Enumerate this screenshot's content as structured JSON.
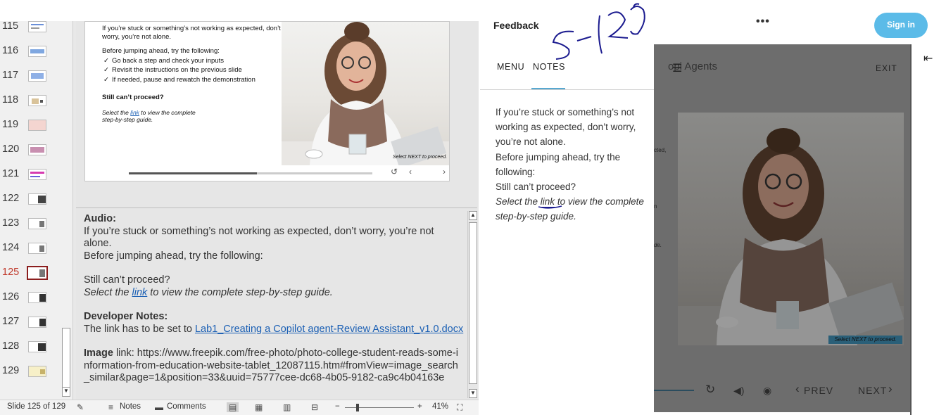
{
  "thumbnails": [
    {
      "num": "115"
    },
    {
      "num": "116"
    },
    {
      "num": "117"
    },
    {
      "num": "118"
    },
    {
      "num": "119"
    },
    {
      "num": "120"
    },
    {
      "num": "121"
    },
    {
      "num": "122"
    },
    {
      "num": "123"
    },
    {
      "num": "124"
    },
    {
      "num": "125"
    },
    {
      "num": "126"
    },
    {
      "num": "127"
    },
    {
      "num": "128"
    },
    {
      "num": "129"
    }
  ],
  "current_slide_num": "125",
  "slide": {
    "p1": "If you’re stuck or something’s not working as expected, don’t worry, you’re not alone.",
    "p2": "Before jumping ahead, try the following:",
    "checks": [
      "Go back a step and check your inputs",
      "Revisit the instructions on the previous slide",
      "If needed, pause and rewatch the demonstration"
    ],
    "bold": "Still can’t proceed?",
    "ital_pre": "Select the ",
    "ital_link": "link",
    "ital_post": " to view the complete step-by-step guide.",
    "photo_caption": "Select NEXT to proceed."
  },
  "notes": {
    "audio_heading": "Audio:",
    "audio_line1": "If you’re stuck or something’s not working as expected, don’t worry, you’re not alone.",
    "audio_line2": "Before jumping ahead, try the following:",
    "audio_line3": "Still can’t proceed?",
    "audio_ital_pre": "Select the ",
    "audio_ital_link": "link",
    "audio_ital_post": " to view the complete step-by-step guide.",
    "dev_heading": "Developer Notes:",
    "dev_pre": "The link has to be set to ",
    "dev_link": "Lab1_Creating a Copilot agent-Review Assistant_v1.0.docx",
    "image_heading": "Image",
    "image_text": " link: https://www.freepik.com/free-photo/photo-college-student-reads-some-information-from-education-website-tablet_12087115.htm#fromView=image_search_similar&page=1&position=33&uuid=75777cee-dc68-4b05-9182-ca9c4b04163e"
  },
  "status": {
    "slide_info": "Slide 125 of 129",
    "notes": "Notes",
    "comments": "Comments",
    "zoom_minus": "−",
    "zoom_plus": "+",
    "zoom": "41%"
  },
  "feedback": {
    "title": "Feedback",
    "more": "•••",
    "sign_in": "Sign in",
    "tab_menu": "MENU",
    "tab_notes": "NOTES",
    "course_title": "opi  Agents",
    "exit": "EXIT",
    "panel_line1": "If you’re stuck or something’s not working as expected, don’t worry, you’re not alone.",
    "panel_line2": "Before jumping ahead, try the following:",
    "panel_line3": "Still can’t proceed?",
    "panel_ital_pre": "Select the ",
    "panel_ital_link": "link",
    "panel_ital_post": " to view the complete step-by-step guide.",
    "photo_caption": "Select NEXT to proceed.",
    "prev": "PREV",
    "next": "NEXT",
    "frag1": "cted,",
    "frag2": "n",
    "frag3": "de."
  },
  "annotation_text": "5-120"
}
